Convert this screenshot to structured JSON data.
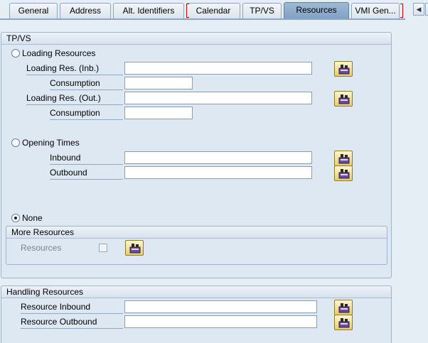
{
  "tabs": [
    {
      "label": "General"
    },
    {
      "label": "Address"
    },
    {
      "label": "Alt. Identifiers"
    },
    {
      "label": "Calendar"
    },
    {
      "label": "TP/VS"
    },
    {
      "label": "Resources"
    },
    {
      "label": "VMI Gen..."
    }
  ],
  "active_tab": "Resources",
  "tpvs": {
    "title": "TP/VS",
    "loading": {
      "radio_label": "Loading Resources",
      "inbound_label": "Loading Res. (Inb.)",
      "inbound_value": "",
      "consumption_label_1": "Consumption",
      "consumption_value_1": "",
      "outbound_label": "Loading Res. (Out.)",
      "outbound_value": "",
      "consumption_label_2": "Consumption",
      "consumption_value_2": ""
    },
    "opening": {
      "radio_label": "Opening Times",
      "inbound_label": "Inbound",
      "inbound_value": "",
      "outbound_label": "Outbound",
      "outbound_value": ""
    },
    "none": {
      "radio_label": "None",
      "selected": true
    },
    "more": {
      "title": "More Resources",
      "resources_label": "Resources",
      "checked": false
    }
  },
  "handling": {
    "title": "Handling Resources",
    "inbound_label": "Resource Inbound",
    "inbound_value": "",
    "outbound_label": "Resource Outbound",
    "outbound_value": ""
  },
  "colors": {
    "background": "#e5edf5",
    "panel": "#dde8f3",
    "active_tab": "#8faacb",
    "focus_bracket": "#cc0000",
    "icon_button": "#e6cf6b"
  },
  "icons": {
    "search_help": "search-help-icon",
    "tab_prev": "chevron-left-icon"
  }
}
